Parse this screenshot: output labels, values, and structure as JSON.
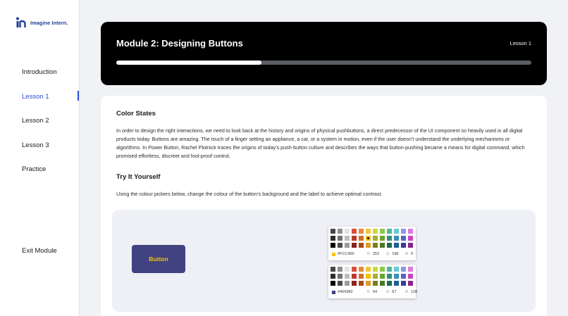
{
  "brand": {
    "name": "Imagine Intern.",
    "color": "#1f3f9c"
  },
  "sidebar": {
    "items": [
      {
        "label": "Introduction",
        "active": false
      },
      {
        "label": "Lesson 1",
        "active": true
      },
      {
        "label": "Lesson 2",
        "active": false
      },
      {
        "label": "Lesson 3",
        "active": false
      },
      {
        "label": "Practice",
        "active": false
      }
    ],
    "exit_label": "Exit Module",
    "active_color": "#2a4bd7"
  },
  "header": {
    "title": "Module 2: Designing Buttons",
    "lesson": "Lesson 1",
    "progress": 0.35
  },
  "content": {
    "heading1": "Color States",
    "paragraph1": "In order to design the right interactions, we need to look back at the history and origins of physical pushbuttons, a direct predecessor of the UI component so heavily used in all digital products today. Buttons are amazing. The touch of a finger setting an appliance, a car, or a system in motion, even if the user doesn’t understand the underlying mechanisms or algorithms. In Power Button, Rachel Plotnick traces the origins of today’s push-button culture and describes the ways that button-pushing became a means for digital command, which promised effortless, discreet and fool-proof control.",
    "heading2": "Try It Yourself",
    "paragraph2": "Using the colour pickers below, change the colour of the button’s background and the label to achieve optimal contrast."
  },
  "demo": {
    "button_label": "Button",
    "button_bg": "#404380",
    "button_fg": "#FCC400"
  },
  "palette": [
    [
      "#484848",
      "#8e8e8e",
      "#e3e3e3",
      "#d4503d",
      "#e58b3a",
      "#f0c63c",
      "#cfd641",
      "#8ec94c",
      "#4fb59d",
      "#6ac7d6",
      "#8a9ae0",
      "#e276e0"
    ],
    [
      "#2e2e2e",
      "#707070",
      "#bdbdbd",
      "#b63a2b",
      "#cd6f27",
      "#f2c200",
      "#a8ad2e",
      "#6ea334",
      "#318c78",
      "#3b8fb8",
      "#5b63c4",
      "#c746c4"
    ],
    [
      "#000000",
      "#4a4a4a",
      "#9c9c9c",
      "#8a2218",
      "#a84a14",
      "#e09b25",
      "#7a7e1c",
      "#4b7820",
      "#1e6756",
      "#1e5f8e",
      "#3a3d9c",
      "#8c2290"
    ]
  ],
  "pickers": [
    {
      "hex": "#FCC400",
      "r": "252",
      "g": "196",
      "b": "0",
      "selected": [
        1,
        5
      ]
    },
    {
      "hex": "#404380",
      "r": "64",
      "g": "67",
      "b": "128",
      "selected": null
    }
  ],
  "labels": {
    "r": "R",
    "g": "G",
    "b": "B"
  }
}
